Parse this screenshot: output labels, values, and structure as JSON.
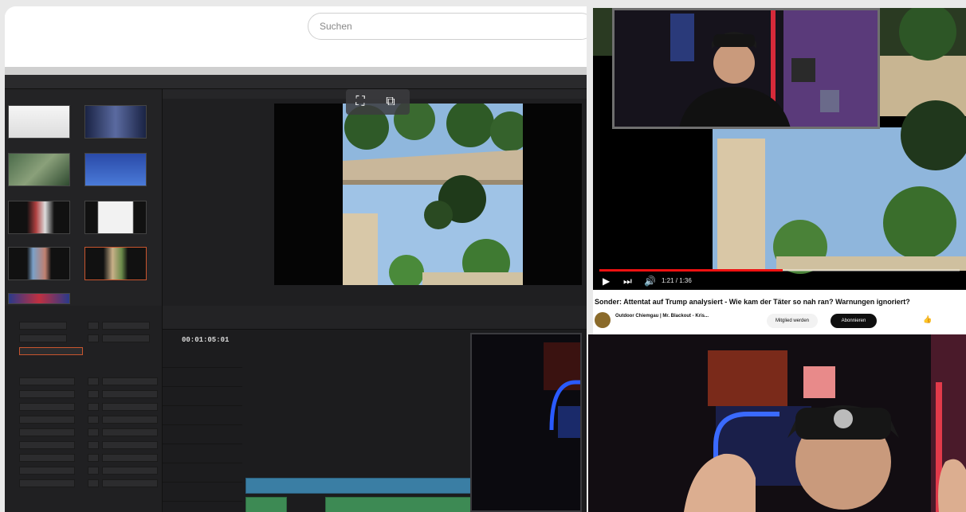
{
  "browser": {
    "search_placeholder": "Suchen"
  },
  "editor": {
    "timecode": "00:01:05:01"
  },
  "youtube": {
    "video_time": "1:21 / 1:36",
    "title": "Sonder: Attentat auf Trump analysiert - Wie kam der Täter so nah ran? Warnungen ignoriert?",
    "channel_name": "Outdoor Chiemgau | Mr. Blackout - Kris...",
    "member_label": "Mitglied werden",
    "subscribe_label": "Abonnieren",
    "progress_fraction": 0.5
  },
  "colors": {
    "accent_red": "#e11111",
    "clip_video": "#3a7ea4",
    "clip_audio": "#3d8a54",
    "selection": "#c8552e"
  },
  "icons": {
    "play": "play-icon",
    "next": "skip-next-icon",
    "volume": "volume-icon",
    "pip": "picture-in-picture-icon",
    "like": "like-icon"
  }
}
